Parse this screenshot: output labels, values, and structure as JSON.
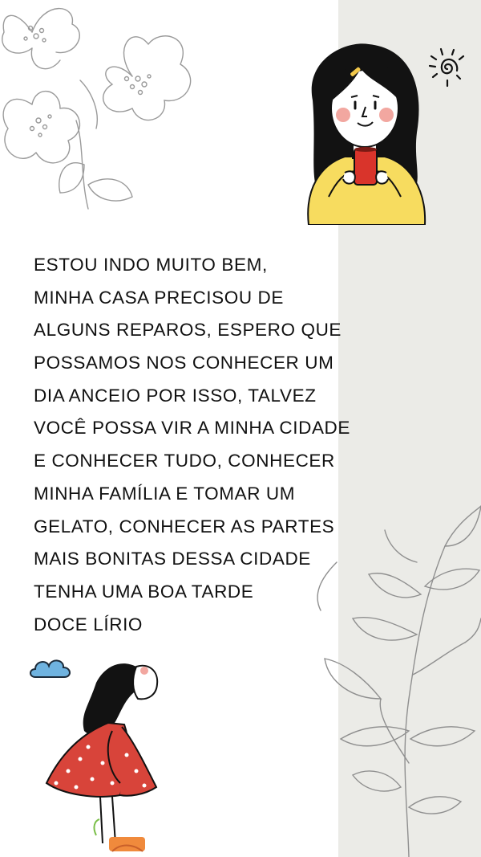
{
  "colors": {
    "panel": "#ebebe7",
    "text": "#111111",
    "sweater": "#f7dc5f",
    "mug": "#d9342b",
    "hair": "#121212",
    "blush": "#f2a7a0",
    "dress": "#d8443a",
    "cloud": "#6fb3e0",
    "sketch": "#9a9a9a"
  },
  "icons": [
    "flower-sketch",
    "girl-with-mug",
    "sun-doodle",
    "leaf-branch-sketch",
    "cloud-doodle",
    "girl-looking-up"
  ],
  "message": {
    "lines": [
      "ESTOU INDO MUITO BEM,",
      "MINHA CASA PRECISOU DE",
      "ALGUNS REPAROS, ESPERO QUE",
      "POSSAMOS NOS CONHECER UM",
      "DIA ANCEIO POR ISSO, TALVEZ",
      "VOCÊ POSSA VIR A MINHA CIDADE",
      "E CONHECER TUDO, CONHECER",
      "MINHA FAMÍLIA E TOMAR UM",
      "GELATO, CONHECER AS PARTES",
      "MAIS BONITAS DESSA CIDADE",
      "TENHA UMA BOA TARDE",
      "DOCE LÍRIO"
    ]
  }
}
